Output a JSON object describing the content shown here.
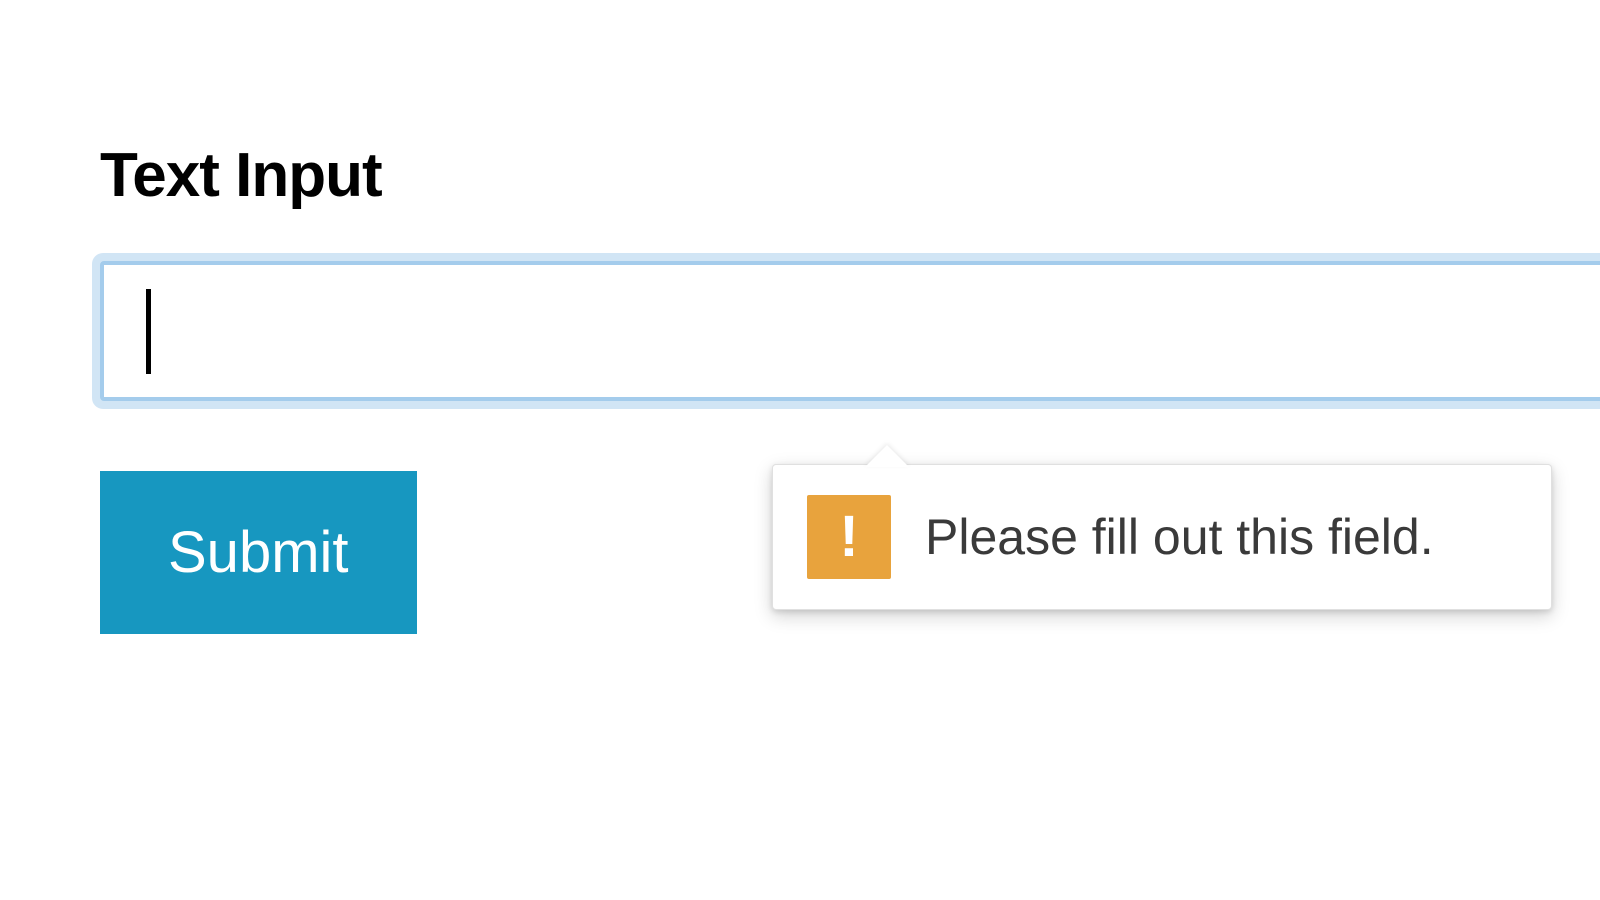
{
  "form": {
    "field_label": "Text Input",
    "input_value": "",
    "submit_label": "Submit"
  },
  "validation": {
    "message": "Please fill out this field.",
    "icon_name": "warning-icon"
  }
}
